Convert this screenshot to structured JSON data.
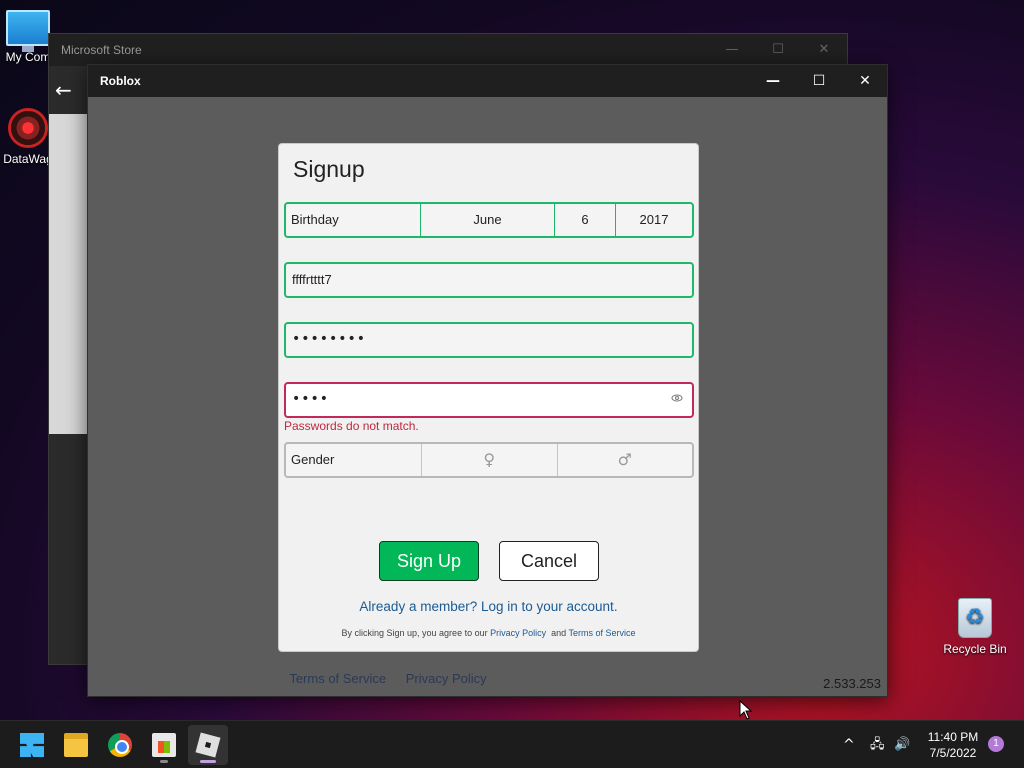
{
  "desktop": {
    "icons": [
      {
        "label": "My Com"
      },
      {
        "label": "DataWag"
      },
      {
        "label": "Recycle Bin"
      }
    ]
  },
  "store_window": {
    "title": "Microsoft Store",
    "back_symbol": "←",
    "min_symbol": "—",
    "max_symbol": "☐",
    "close_symbol": "✕"
  },
  "roblox_window": {
    "title": "Roblox",
    "min_symbol": "—",
    "max_symbol": "☐",
    "close_symbol": "✕",
    "footer": {
      "terms": "Terms of Service",
      "privacy": "Privacy Policy"
    },
    "version": "2.533.253"
  },
  "signup": {
    "title": "Signup",
    "birthday": {
      "label": "Birthday",
      "month": "June",
      "day": "6",
      "year": "2017"
    },
    "username": {
      "value": "ffffrtttt7"
    },
    "password": {
      "value": "••••••••"
    },
    "confirm_password": {
      "value": "••••"
    },
    "error_message": "Passwords do not match.",
    "gender": {
      "label": "Gender",
      "female_icon": "♀",
      "male_icon": "♂"
    },
    "signup_button": "Sign Up",
    "cancel_button": "Cancel",
    "login_link": "Already a member? Log in to your account.",
    "legal": {
      "prefix": "By clicking Sign up, you agree to our ",
      "privacy": "Privacy Policy",
      "and": "  and ",
      "terms": "Terms of Service"
    }
  },
  "taskbar": {
    "apps": [
      "start",
      "file-explorer",
      "chrome",
      "microsoft-store",
      "roblox"
    ],
    "tray": {
      "chevron": "^",
      "network": "🖧",
      "volume": "🔊"
    },
    "time": "11:40 PM",
    "date": "7/5/2022",
    "notification_count": "1"
  },
  "colors": {
    "field_valid": "#1fb86a",
    "field_error": "#c2285a",
    "signup_button": "#02b757",
    "link": "#1b5a94"
  }
}
